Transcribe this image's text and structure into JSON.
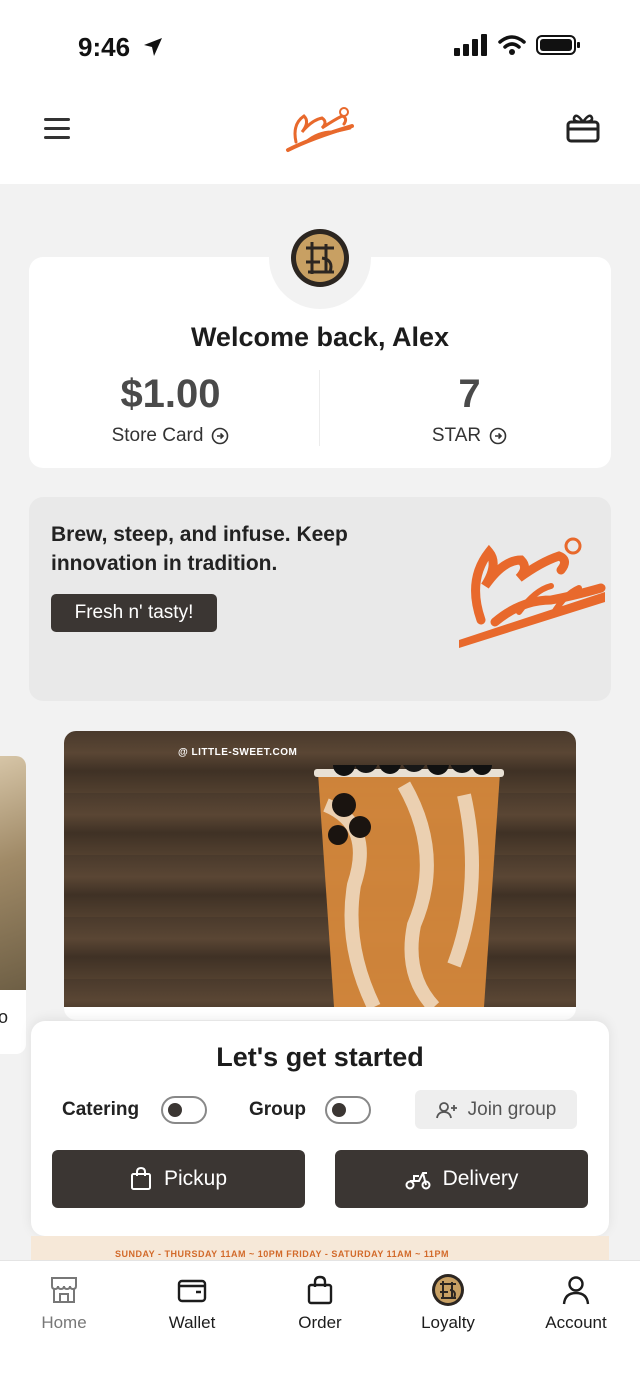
{
  "status_bar": {
    "time": "9:46"
  },
  "header": {
    "logo_alt": "Little Sweet"
  },
  "welcome": {
    "title": "Welcome back, Alex",
    "store_card_value": "$1.00",
    "store_card_label": "Store Card",
    "star_value": "7",
    "star_label": "STAR"
  },
  "promo": {
    "text": "Brew, steep, and infuse. Keep innovation in tradition.",
    "pill": "Fresh n' tasty!"
  },
  "feature": {
    "caption": "@ LITTLE-SWEET.COM",
    "side_text": "o"
  },
  "start": {
    "title": "Let's get started",
    "catering_label": "Catering",
    "group_label": "Group",
    "join_group_label": "Join group",
    "pickup_label": "Pickup",
    "delivery_label": "Delivery"
  },
  "banner": {
    "text": "SUNDAY - THURSDAY  11AM ~ 10PM        FRIDAY - SATURDAY  11AM ~ 11PM"
  },
  "tabbar": {
    "items": [
      {
        "label": "Home",
        "icon": "store-icon"
      },
      {
        "label": "Wallet",
        "icon": "wallet-icon"
      },
      {
        "label": "Order",
        "icon": "bag-icon"
      },
      {
        "label": "Loyalty",
        "icon": "loyalty-badge-icon"
      },
      {
        "label": "Account",
        "icon": "person-icon"
      }
    ]
  },
  "colors": {
    "brand_orange": "#e8692c",
    "dark_button": "#3b3633",
    "background": "#f2f2f2"
  }
}
